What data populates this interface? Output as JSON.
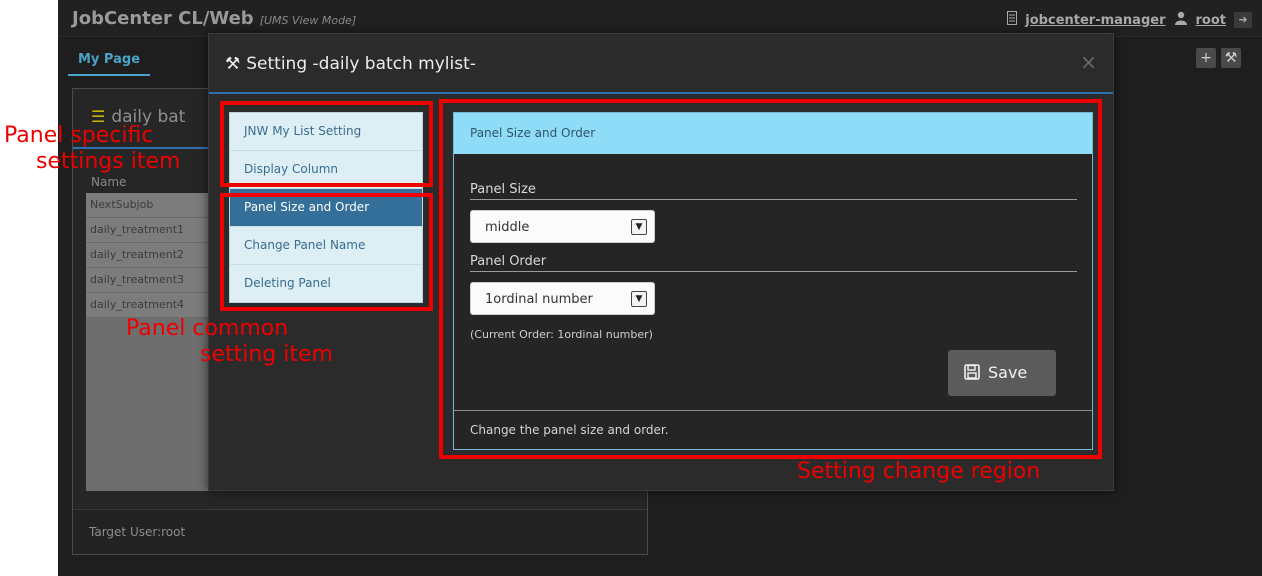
{
  "app": {
    "title": "JobCenter CL/Web",
    "mode": "[UMS View Mode]",
    "manager": "jobcenter-manager",
    "user": "root"
  },
  "page_tab": "My Page",
  "background_panel": {
    "title": "daily bat",
    "column_header": "Name",
    "rows": [
      "NextSubjob",
      "daily_treatment1",
      "daily_treatment2",
      "daily_treatment3",
      "daily_treatment4"
    ],
    "footer": "Target User:root"
  },
  "modal": {
    "title": "Setting -daily batch mylist-",
    "close": "×",
    "menu_items": [
      {
        "label": "JNW My List Setting"
      },
      {
        "label": "Display Column"
      },
      {
        "label": "Panel Size and Order"
      },
      {
        "label": "Change Panel Name"
      },
      {
        "label": "Deleting Panel"
      }
    ],
    "active_menu_index": 2,
    "content": {
      "header": "Panel Size and Order",
      "panel_size_label": "Panel Size",
      "panel_size_value": "middle",
      "panel_order_label": "Panel Order",
      "panel_order_value": "1ordinal number",
      "current_order_note": "(Current Order: 1ordinal number)",
      "save_label": "Save",
      "footer": "Change the panel size and order."
    }
  },
  "annotations": {
    "specific_line1": "Panel specific",
    "specific_line2": "settings item",
    "common_line1": "Panel common",
    "common_line2": "setting item",
    "region": "Setting change region",
    "color": "#ee0000"
  },
  "colors": {
    "accent": "#2f6fb0",
    "menu_active": "#336f99",
    "content_header": "#8fdcf8"
  }
}
